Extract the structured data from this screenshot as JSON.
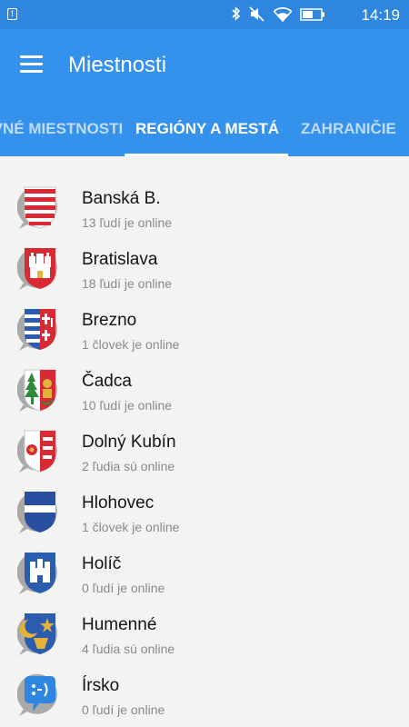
{
  "status_bar": {
    "time": "14:19",
    "icons": [
      "notification-icon",
      "bluetooth-icon",
      "mute-icon",
      "wifi-icon",
      "battery-icon"
    ]
  },
  "header": {
    "title": "Miestnosti"
  },
  "tabs": [
    {
      "label": "HLAVNÉ MIESTNOSTI",
      "active": false
    },
    {
      "label": "REGIÓNY A MESTÁ",
      "active": true
    },
    {
      "label": "ZAHRANIČIE",
      "active": false
    }
  ],
  "rooms": [
    {
      "name": "Banská B.",
      "status": "13 ľudí je online",
      "icon": "banska-bystrica-coat-of-arms-icon"
    },
    {
      "name": "Bratislava",
      "status": "18 ľudí je online",
      "icon": "bratislava-coat-of-arms-icon"
    },
    {
      "name": "Brezno",
      "status": "1 človek je online",
      "icon": "brezno-coat-of-arms-icon"
    },
    {
      "name": "Čadca",
      "status": "10 ľudí je online",
      "icon": "cadca-coat-of-arms-icon"
    },
    {
      "name": "Dolný Kubín",
      "status": "2 ľudia sú online",
      "icon": "dolny-kubin-coat-of-arms-icon"
    },
    {
      "name": "Hlohovec",
      "status": "1 človek je online",
      "icon": "hlohovec-coat-of-arms-icon"
    },
    {
      "name": "Holíč",
      "status": "0 ľudí je online",
      "icon": "holic-coat-of-arms-icon"
    },
    {
      "name": "Humenné",
      "status": "4 ľudia sú online",
      "icon": "humenne-coat-of-arms-icon"
    },
    {
      "name": "Írsko",
      "status": "0 ľudí je online",
      "icon": "chat-smiley-icon"
    }
  ],
  "colors": {
    "primary": "#3592ec",
    "status_bar": "#2f86e0",
    "background": "#f3f3f1",
    "tab_inactive": "#bfdcfa"
  }
}
